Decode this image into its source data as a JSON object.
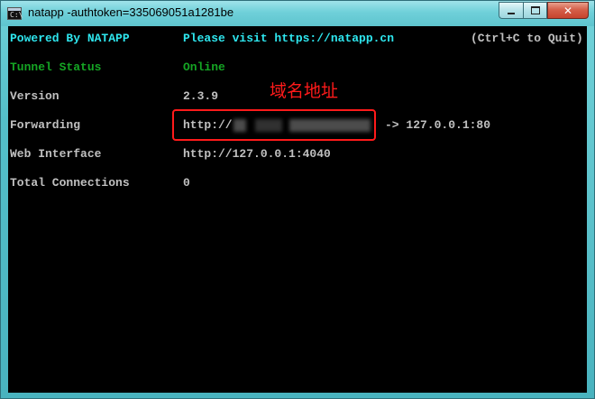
{
  "window": {
    "title": "natapp  -authtoken=335069051a1281be",
    "icon_name": "console-icon",
    "controls": {
      "minimize": "minimize-icon",
      "maximize": "maximize-icon",
      "close": "close-icon",
      "close_glyph": "✕"
    }
  },
  "console": {
    "header": {
      "powered_by": "Powered By NATAPP",
      "visit": "Please visit https://natapp.cn",
      "quit_hint": "(Ctrl+C to Quit)"
    },
    "rows": [
      {
        "label": "Tunnel Status",
        "value": "Online"
      },
      {
        "label": "Version",
        "value": "2.3.9"
      },
      {
        "label": "Forwarding",
        "value_prefix": "http://",
        "value_suffix": "-> 127.0.0.1:80"
      },
      {
        "label": "Web Interface",
        "value": "http://127.0.0.1:4040"
      },
      {
        "label": "Total Connections",
        "value": "0"
      }
    ]
  },
  "annotation": {
    "text": "域名地址",
    "color": "#ff1a1a"
  },
  "colors": {
    "header_cyan": "#2ee6ee",
    "status_green": "#15a524",
    "text_grey": "#c0c0c0",
    "background": "#000000"
  }
}
